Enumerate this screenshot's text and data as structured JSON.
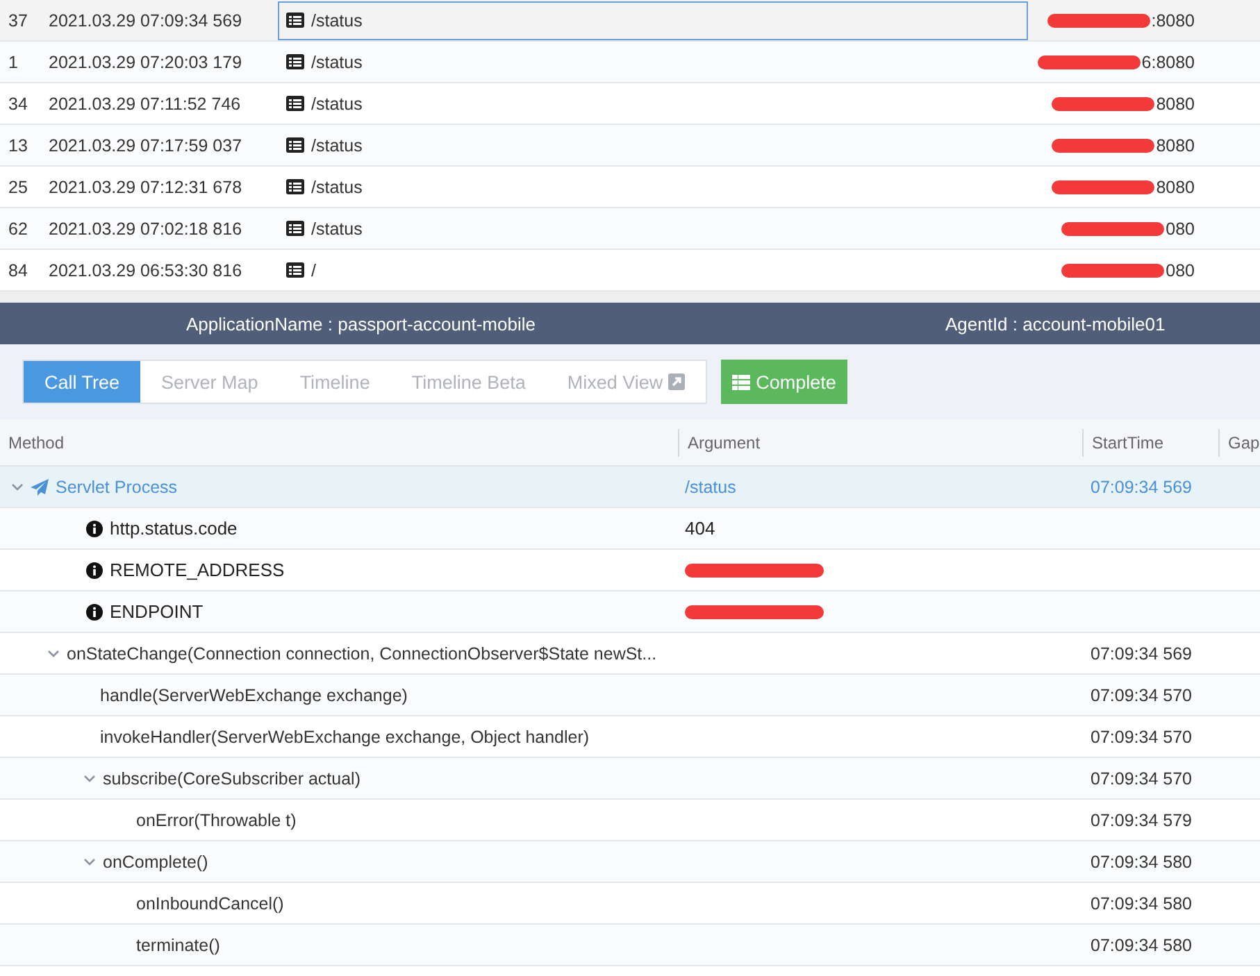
{
  "transactions": [
    {
      "index": "37",
      "time": "2021.03.29 07:09:34 569",
      "path": "/status",
      "address": {
        "redacted": true,
        "text": ":8080"
      },
      "selected": true
    },
    {
      "index": "1",
      "time": "2021.03.29 07:20:03 179",
      "path": "/status",
      "address": {
        "redacted": true,
        "text": "6:8080"
      },
      "selected": false
    },
    {
      "index": "34",
      "time": "2021.03.29 07:11:52 746",
      "path": "/status",
      "address": {
        "redacted": true,
        "text": "8080"
      },
      "selected": false
    },
    {
      "index": "13",
      "time": "2021.03.29 07:17:59 037",
      "path": "/status",
      "address": {
        "redacted": true,
        "text": "8080"
      },
      "selected": false
    },
    {
      "index": "25",
      "time": "2021.03.29 07:12:31 678",
      "path": "/status",
      "address": {
        "redacted": true,
        "text": "8080"
      },
      "selected": false
    },
    {
      "index": "62",
      "time": "2021.03.29 07:02:18 816",
      "path": "/status",
      "address": {
        "redacted": true,
        "text": "080"
      },
      "selected": false
    },
    {
      "index": "84",
      "time": "2021.03.29 06:53:30 816",
      "path": "/",
      "address": {
        "redacted": true,
        "text": "080"
      },
      "selected": false
    }
  ],
  "info_bar": {
    "application_name": "ApplicationName : passport-account-mobile",
    "agent_id": "AgentId : account-mobile01"
  },
  "tabs": [
    {
      "label": "Call Tree",
      "selected": true,
      "external": false
    },
    {
      "label": "Server Map",
      "selected": false,
      "external": false
    },
    {
      "label": "Timeline",
      "selected": false,
      "external": false
    },
    {
      "label": "Timeline Beta",
      "selected": false,
      "external": false
    },
    {
      "label": "Mixed View",
      "selected": false,
      "external": true
    }
  ],
  "complete_button": "Complete",
  "columns": [
    "Method",
    "Argument",
    "StartTime",
    "Gap"
  ],
  "call_tree": [
    {
      "kind": "entry",
      "method": "Servlet Process",
      "argument": "/status",
      "start_time": "07:09:34 569",
      "expanded": true,
      "children": [
        {
          "kind": "info",
          "method": "http.status.code",
          "argument": "404"
        },
        {
          "kind": "info",
          "method": "REMOTE_ADDRESS",
          "argument_redacted": true
        },
        {
          "kind": "info",
          "method": "ENDPOINT",
          "argument_redacted": true
        },
        {
          "kind": "call",
          "method": "onStateChange(Connection connection, ConnectionObserver$State newSt...",
          "start_time": "07:09:34 569",
          "expanded": true,
          "children": [
            {
              "kind": "call",
              "method": "handle(ServerWebExchange exchange)",
              "start_time": "07:09:34 570"
            },
            {
              "kind": "call",
              "method": "invokeHandler(ServerWebExchange exchange, Object handler)",
              "start_time": "07:09:34 570"
            },
            {
              "kind": "call",
              "method": "subscribe(CoreSubscriber actual)",
              "start_time": "07:09:34 570",
              "expanded": true,
              "children": [
                {
                  "kind": "call",
                  "method": "onError(Throwable t)",
                  "start_time": "07:09:34 579"
                }
              ]
            },
            {
              "kind": "call",
              "method": "onComplete()",
              "start_time": "07:09:34 580",
              "expanded": true,
              "children": [
                {
                  "kind": "call",
                  "method": "onInboundCancel()",
                  "start_time": "07:09:34 580"
                },
                {
                  "kind": "call",
                  "method": "terminate()",
                  "start_time": "07:09:34 580"
                }
              ]
            }
          ]
        }
      ]
    }
  ]
}
